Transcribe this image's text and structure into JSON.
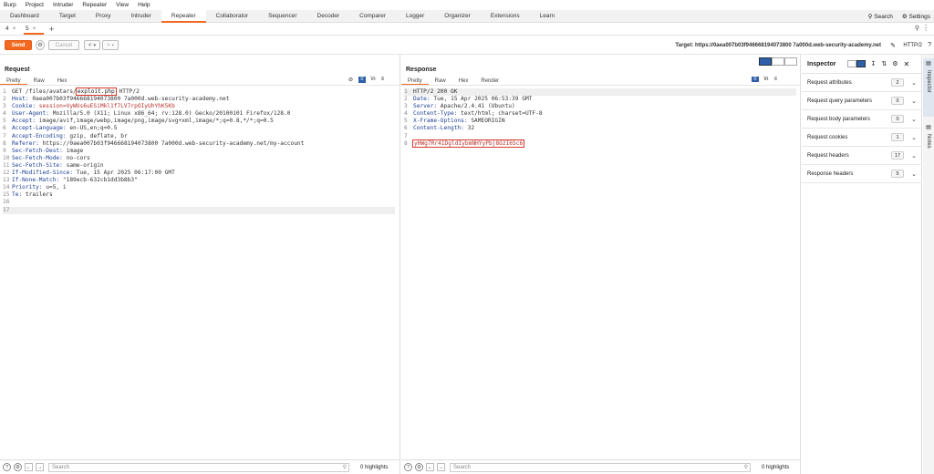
{
  "menu": [
    "Burp",
    "Project",
    "Intruder",
    "Repeater",
    "View",
    "Help"
  ],
  "tools": [
    "Dashboard",
    "Target",
    "Proxy",
    "Intruder",
    "Repeater",
    "Collaborator",
    "Sequencer",
    "Decoder",
    "Comparer",
    "Logger",
    "Organizer",
    "Extensions",
    "Learn"
  ],
  "toolbar_right": {
    "search": "Search",
    "settings": "Settings"
  },
  "subtabs": [
    {
      "label": "4",
      "close": "×"
    },
    {
      "label": "5",
      "close": "×"
    }
  ],
  "add_tab": "+",
  "actions": {
    "send": "Send",
    "cancel": "Cancel",
    "back": "<",
    "forward": ">"
  },
  "target": "Target: https://0aea007b03f946668194073800 7a000d.web-security-academy.net",
  "protocol": "HTTP/2",
  "request": {
    "title": "Request",
    "tabs": [
      "Pretty",
      "Raw",
      "Hex"
    ],
    "lines": [
      {
        "n": "1",
        "pre": "GET /files/avatars/",
        "box": "exploit.php",
        "post": " HTTP/2"
      },
      {
        "n": "2",
        "key": "Host:",
        "val": " 0aea007b03f946668194073800 7a000d.web-security-academy.net"
      },
      {
        "n": "3",
        "key": "Cookie:",
        "cookie": " session=VyWUs6uESiMkl1f7LV7rpOIyUhYhK5Kb"
      },
      {
        "n": "4",
        "key": "User-Agent:",
        "val": " Mozilla/5.0 (X11; Linux x86_64; rv:128.0) Gecko/20100101 Firefox/128.0"
      },
      {
        "n": "5",
        "key": "Accept:",
        "val": " image/avif,image/webp,image/png,image/svg+xml,image/*;q=0.8,*/*;q=0.5"
      },
      {
        "n": "6",
        "key": "Accept-Language:",
        "val": " en-US,en;q=0.5"
      },
      {
        "n": "7",
        "key": "Accept-Encoding:",
        "val": " gzip, deflate, br"
      },
      {
        "n": "8",
        "key": "Referer:",
        "val": " https://0aea007b03f946668194073800 7a000d.web-security-academy.net/my-account"
      },
      {
        "n": "9",
        "key": "Sec-Fetch-Dest:",
        "val": " image"
      },
      {
        "n": "10",
        "key": "Sec-Fetch-Mode:",
        "val": " no-cors"
      },
      {
        "n": "11",
        "key": "Sec-Fetch-Site:",
        "val": " same-origin"
      },
      {
        "n": "12",
        "key": "If-Modified-Since:",
        "val": " Tue, 15 Apr 2025 06:17:00 GMT"
      },
      {
        "n": "13",
        "key": "If-None-Match:",
        "val": " \"189ecb-632cb1dd3b8b3\""
      },
      {
        "n": "14",
        "key": "Priority:",
        "val": " u=5, i"
      },
      {
        "n": "15",
        "key": "Te:",
        "val": " trailers"
      },
      {
        "n": "16"
      },
      {
        "n": "17"
      }
    ],
    "footer": {
      "search": "Search",
      "highlights": "0 highlights"
    }
  },
  "response": {
    "title": "Response",
    "tabs": [
      "Pretty",
      "Raw",
      "Hex",
      "Render"
    ],
    "lines": [
      {
        "n": "1",
        "pre": "HTTP/2 200 OK"
      },
      {
        "n": "2",
        "key": "Date:",
        "val": " Tue, 15 Apr 2025 06:53:39 GMT"
      },
      {
        "n": "3",
        "key": "Server:",
        "val": " Apache/2.4.41 (Ubuntu)"
      },
      {
        "n": "4",
        "key": "Content-Type:",
        "val": " text/html; charset=UTF-8"
      },
      {
        "n": "5",
        "key": "X-Frame-Options:",
        "val": " SAMEORIGIN"
      },
      {
        "n": "6",
        "key": "Content-Length:",
        "val": " 32"
      },
      {
        "n": "7"
      },
      {
        "n": "8",
        "box": "yHWg7Rr41DgldIybmNHYyPbj8O2I6Sc6"
      }
    ],
    "footer": {
      "search": "Search",
      "highlights": "0 highlights"
    }
  },
  "inspector": {
    "title": "Inspector",
    "rows": [
      {
        "label": "Request attributes",
        "count": "2"
      },
      {
        "label": "Request query parameters",
        "count": "0"
      },
      {
        "label": "Request body parameters",
        "count": "0"
      },
      {
        "label": "Request cookies",
        "count": "1"
      },
      {
        "label": "Request headers",
        "count": "17"
      },
      {
        "label": "Response headers",
        "count": "5"
      }
    ]
  },
  "side_tabs": [
    "Inspector",
    "Notes"
  ],
  "colors": {
    "accent": "#f26a21",
    "header_key": "#1c3f95",
    "cookie": "#b7322c",
    "highlight_box": "#d73a2f"
  }
}
